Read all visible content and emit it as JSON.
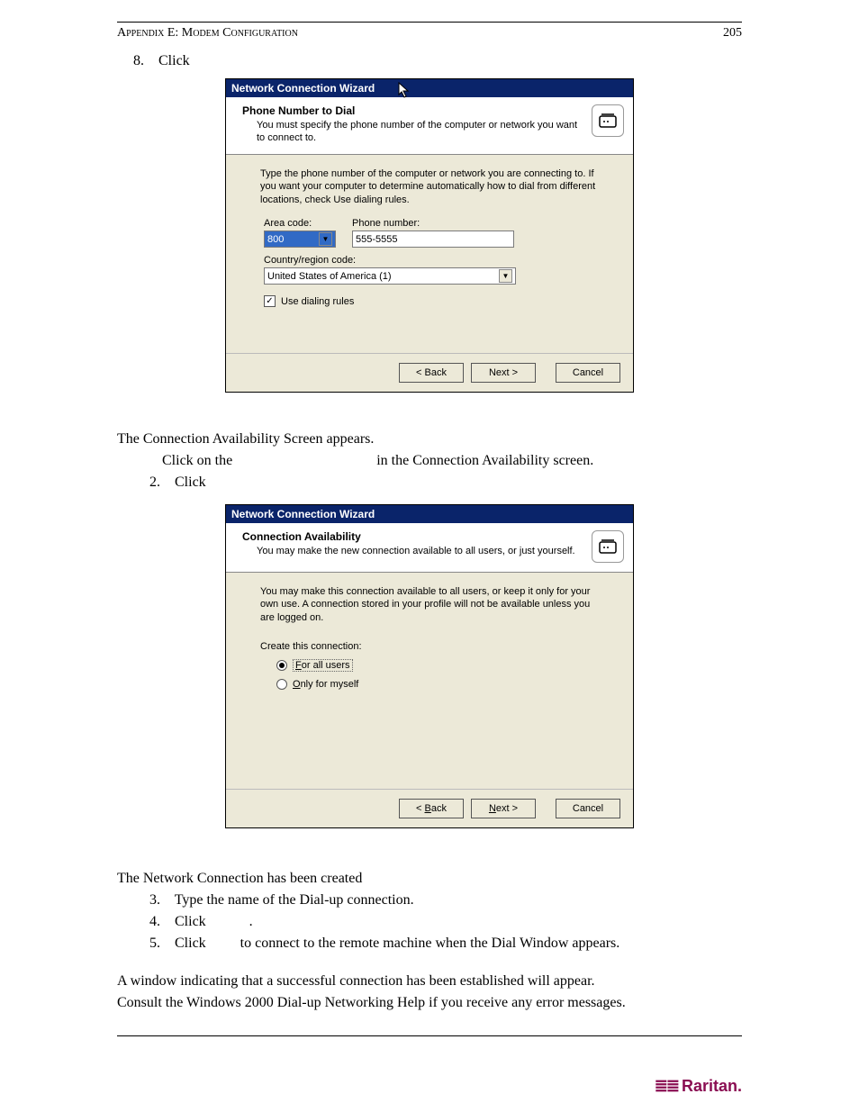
{
  "page": {
    "header_left": "Appendix E: Modem Configuration",
    "header_right": "205"
  },
  "step8": {
    "num": "8.",
    "label": "Click"
  },
  "dialog1": {
    "title": "Network Connection Wizard",
    "h_title": "Phone Number to Dial",
    "h_sub": "You must specify the phone number of the computer or network you want to connect to.",
    "body_intro": "Type the phone number of the computer or network you are connecting to. If you want your computer to determine automatically how to dial from different locations, check Use dialing rules.",
    "area_label": "Area code:",
    "area_value": "800",
    "phone_label": "Phone number:",
    "phone_value": "555-5555",
    "country_label": "Country/region code:",
    "country_value": "United States of America (1)",
    "check_label": "Use dialing rules",
    "btn_back": "< Back",
    "btn_next": "Next >",
    "btn_cancel": "Cancel"
  },
  "mid_text": {
    "line1a": "The ",
    "line1b": "Connection Availability Screen appears.",
    "line2a": "Click on the",
    "line2b": "in the Connection Availability screen.",
    "step2_num": "2.",
    "step2_label": "Click"
  },
  "dialog2": {
    "title": "Network Connection Wizard",
    "h_title": "Connection Availability",
    "h_sub": "You may make the new connection available to all users, or just yourself.",
    "body_intro": "You may make this connection available to all users, or keep it only for your own use.  A connection stored in your profile will not be available unless you are logged on.",
    "create_label": "Create this connection:",
    "radio1": "For all users",
    "radio2": "Only for myself",
    "btn_back": "< Back",
    "btn_next": "Next >",
    "btn_cancel": "Cancel"
  },
  "bottom_text": {
    "line1": "The Network Connection has been created",
    "step3_num": "3.",
    "step3": "Type the name of the Dial-up connection.",
    "step4_num": "4.",
    "step4a": "Click",
    "step4b": ".",
    "step5_num": "5.",
    "step5a": "Click",
    "step5b": "to connect to the remote machine when the Dial Window appears.",
    "line2": "A window indicating that a successful connection has been established will appear.",
    "line3": "Consult the Windows 2000 Dial-up Networking Help if you receive any error messages."
  },
  "footer": {
    "brand": "Raritan."
  }
}
